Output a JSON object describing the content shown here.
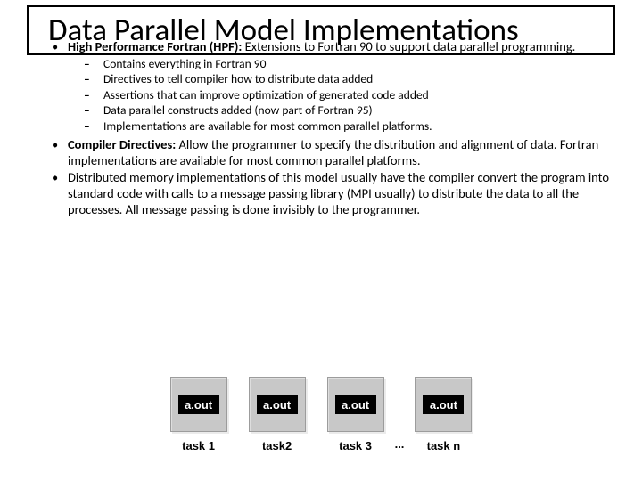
{
  "title": "Data Parallel Model Implementations",
  "bullets": [
    {
      "bold": "High Performance Fortran (HPF):",
      "rest": " Extensions to Fortran 90 to support data parallel programming.",
      "sub": [
        "Contains everything in Fortran 90",
        "Directives to tell compiler how to distribute data added",
        "Assertions that can improve optimization of generated code added",
        "Data parallel constructs added (now part of Fortran 95)",
        "Implementations are available for most common parallel platforms."
      ]
    },
    {
      "bold": "Compiler Directives:",
      "rest": " Allow the programmer to specify the distribution and alignment of data. Fortran implementations are available for most common parallel platforms."
    },
    {
      "bold": "",
      "rest": "Distributed memory implementations of this model usually have the compiler convert the program into standard code with calls to a message passing library (MPI usually) to distribute the data to all the processes. All message passing is done invisibly to the programmer."
    }
  ],
  "diagram": {
    "box_label": "a.out",
    "tasks": [
      "task 1",
      "task2",
      "task 3",
      "task n"
    ],
    "ellipsis": "..."
  }
}
